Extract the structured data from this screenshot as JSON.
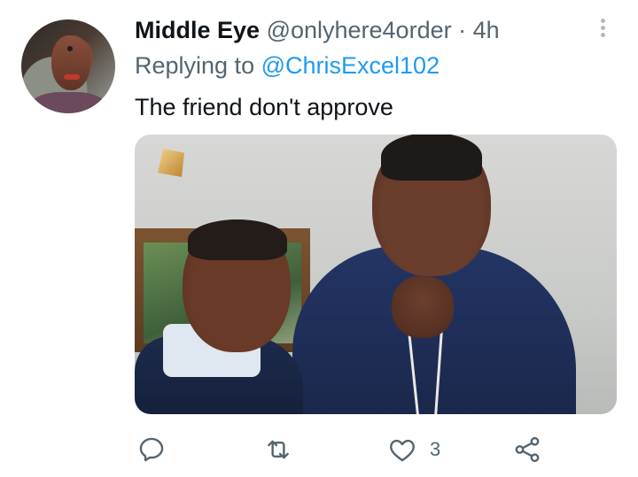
{
  "tweet": {
    "author_name": "Middle Eye",
    "handle": "@onlyhere4order",
    "separator": "·",
    "time": "4h",
    "reply_prefix": "Replying to",
    "reply_to": "@ChrisExcel102",
    "text": "The friend don't approve"
  },
  "actions": {
    "reply_icon": "reply-icon",
    "retweet_icon": "retweet-icon",
    "like_icon": "heart-icon",
    "like_count": "3",
    "share_icon": "share-icon"
  },
  "colors": {
    "link": "#1d9bf0",
    "muted": "#536471",
    "text": "#0f1419"
  }
}
